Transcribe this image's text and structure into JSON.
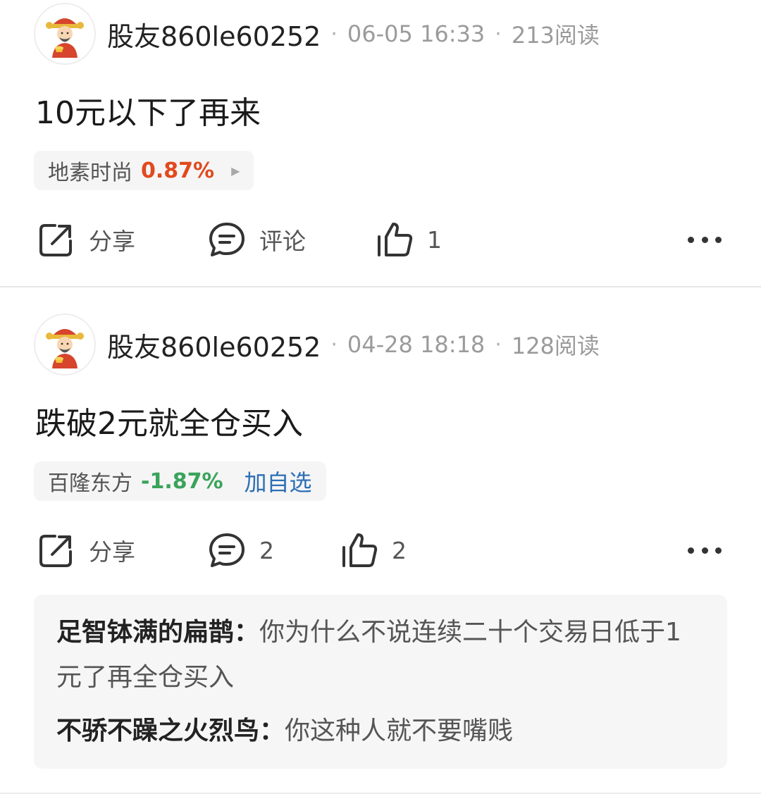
{
  "posts": [
    {
      "username": "股友860le60252",
      "separator": "·",
      "date": "06-05 16:33",
      "reads": "213阅读",
      "content": "10元以下了再来",
      "stock": {
        "name": "地素时尚",
        "change": "0.87%",
        "trend": "up",
        "arrow": "▶"
      },
      "actions": {
        "share": "分享",
        "comment": "评论",
        "like": "1"
      }
    },
    {
      "username": "股友860le60252",
      "separator": "·",
      "date": "04-28 18:18",
      "reads": "128阅读",
      "content": "跌破2元就全仓买入",
      "stock": {
        "name": "百隆东方",
        "change": "-1.87%",
        "trend": "down",
        "watch": "加自选"
      },
      "actions": {
        "share": "分享",
        "comment": "2",
        "like": "2"
      },
      "comments": [
        {
          "author": "足智钵满的扁鹊：",
          "text": "你为什么不说连续二十个交易日低于1元了再全仓买入"
        },
        {
          "author": "不骄不躁之火烈鸟：",
          "text": "你这种人就不要嘴贱"
        }
      ]
    }
  ],
  "colors": {
    "up": "#e14a1d",
    "down": "#3aa35a",
    "link": "#2c6fb5",
    "text_primary": "#222222",
    "text_secondary": "#9b9b9b",
    "tag_background": "#f5f5f6"
  },
  "icons": {
    "avatar": "fortune-god-avatar",
    "share": "share-icon",
    "comment": "comment-bubble-icon",
    "like": "thumbs-up-icon",
    "more": "more-dots-icon"
  }
}
